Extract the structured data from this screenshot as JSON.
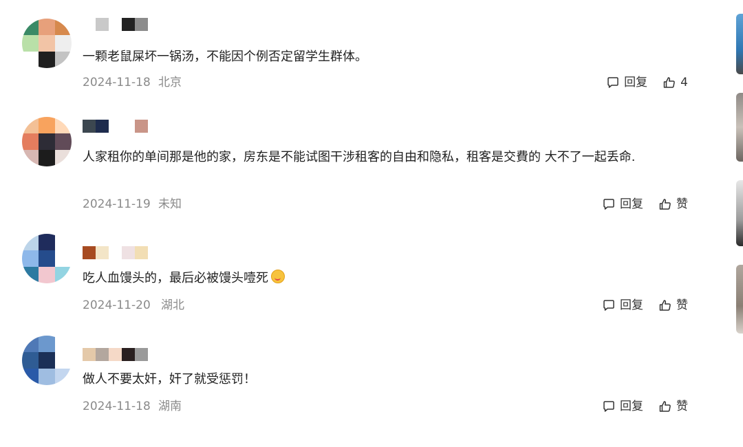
{
  "labels": {
    "reply": "回复"
  },
  "comments": [
    {
      "text": "一颗老鼠屎坏一锅汤，不能因个例否定留学生群体。",
      "date": "2024-11-18",
      "location": "北京",
      "like": "4"
    },
    {
      "text": "人家租你的单间那是他的家，房东是不能试图干涉租客的自由和隐私，租客是交費的 大不了一起丢命.",
      "date": "2024-11-19",
      "location": "未知",
      "like": "赞"
    },
    {
      "text": "吃人血馒头的，最后必被馒头噎死",
      "date": "2024-11-20",
      "location": "湖北",
      "like": "赞"
    },
    {
      "text": "做人不要太奸，奸了就受惩罚！",
      "date": "2024-11-18",
      "location": "湖南",
      "like": "赞"
    }
  ],
  "colors": {
    "text": "#222222",
    "meta": "#8a8a8a",
    "avatar_0": [
      "#3a8a66",
      "#e7a07b",
      "#d6894d",
      "#b9e0a8",
      "#f2c4a6",
      "#eeeeee",
      "#ffffff",
      "#1f1f1f",
      "#c3c3c3"
    ],
    "avatar_1": [
      "#f3c096",
      "#f8a35e",
      "#ffd9b8",
      "#e47d5e",
      "#2d2c36",
      "#614b58",
      "#d7b7b2",
      "#1c1c1c",
      "#eadfdb"
    ],
    "avatar_2": [
      "#bcd4e9",
      "#1f2c5c",
      "#ffffff",
      "#8eb8ea",
      "#254c8c",
      "#ffffff",
      "#2d7aa1",
      "#f2c7cf",
      "#93d4e2"
    ],
    "avatar_3": [
      "#4f79b6",
      "#6c98cd",
      "#ffffff",
      "#2f5c94",
      "#1b3057",
      "#ffffff",
      "#2a5aa8",
      "#9fbde1",
      "#c3d6ef"
    ],
    "name_0": [
      "#ffffff",
      "#c9c9c9",
      "#ffffff",
      "#222222",
      "#8c8c8c"
    ],
    "name_1": [
      "#3c4750",
      "#1e2c4d",
      "#ffffff",
      "#ffffff",
      "#c99588"
    ],
    "name_2": [
      "#a74b21",
      "#f3e5c7",
      "#ffffff",
      "#efe1e3",
      "#f2deb4"
    ],
    "name_3": [
      "#e4c9a9",
      "#b3a79e",
      "#f5d9c7",
      "#2a2020",
      "#9a9a9a"
    ]
  }
}
